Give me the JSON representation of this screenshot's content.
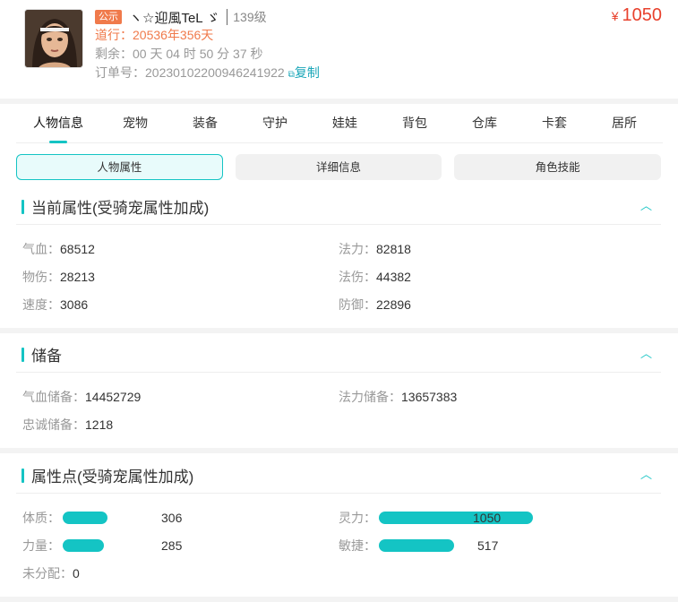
{
  "header": {
    "badge": "公示",
    "nickname": "ヽ☆迎風TeL ゞ",
    "level": "139级",
    "play_time_label": "道行：",
    "play_time": "20536年356天",
    "remain_label": "剩余：",
    "remain": "00 天 04 时 50 分 37 秒",
    "order_label": "订单号：",
    "order_no": "20230102200946241922",
    "copy_label": "复制",
    "currency": "¥",
    "price": "1050"
  },
  "tabs": [
    "人物信息",
    "宠物",
    "装备",
    "守护",
    "娃娃",
    "背包",
    "仓库",
    "卡套",
    "居所"
  ],
  "subtabs": [
    "人物属性",
    "详细信息",
    "角色技能"
  ],
  "sections": {
    "current": {
      "title": "当前属性(受骑宠属性加成)",
      "stats": [
        {
          "label": "气血：",
          "value": "68512"
        },
        {
          "label": "法力：",
          "value": "82818"
        },
        {
          "label": "物伤：",
          "value": "28213"
        },
        {
          "label": "法伤：",
          "value": "44382"
        },
        {
          "label": "速度：",
          "value": "3086"
        },
        {
          "label": "防御：",
          "value": "22896"
        }
      ]
    },
    "reserve": {
      "title": "储备",
      "stats": [
        {
          "label": "气血储备：",
          "value": "14452729"
        },
        {
          "label": "法力储备：",
          "value": "13657383"
        },
        {
          "label": "忠诚储备：",
          "value": "1218"
        }
      ]
    },
    "points": {
      "title": "属性点(受骑宠属性加成)",
      "bars": [
        {
          "label": "体质：",
          "value": "306",
          "fill": 0.29
        },
        {
          "label": "灵力：",
          "value": "1050",
          "fill": 1.0
        },
        {
          "label": "力量：",
          "value": "285",
          "fill": 0.27
        },
        {
          "label": "敏捷：",
          "value": "517",
          "fill": 0.49
        }
      ],
      "unassigned_label": "未分配：",
      "unassigned_value": "0"
    }
  },
  "colors": {
    "accent": "#14c4c4",
    "price": "#e8412d",
    "orange": "#f07a4b"
  },
  "icons": {
    "chevron": "chevron-up-icon",
    "copy": "copy-icon"
  }
}
